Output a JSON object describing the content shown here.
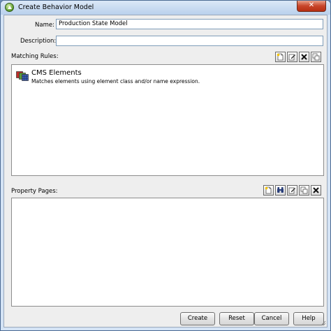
{
  "window": {
    "title": "Create Behavior Model"
  },
  "form": {
    "name_label": "Name:",
    "name_value": "Production State Model",
    "description_label": "Description:",
    "description_value": ""
  },
  "matching_rules": {
    "label": "Matching Rules:",
    "items": [
      {
        "title": "CMS Elements",
        "description": "Matches elements using element class and/or name expression."
      }
    ]
  },
  "property_pages": {
    "label": "Property Pages:"
  },
  "buttons": {
    "create": "Create",
    "reset": "Reset",
    "cancel": "Cancel",
    "help": "Help"
  },
  "icons": {
    "window": "app-icon",
    "new": "new-icon",
    "edit": "edit-icon",
    "delete": "delete-icon",
    "copy": "copy-icon",
    "find": "binoculars-icon",
    "rule": "cms-elements-icon"
  }
}
